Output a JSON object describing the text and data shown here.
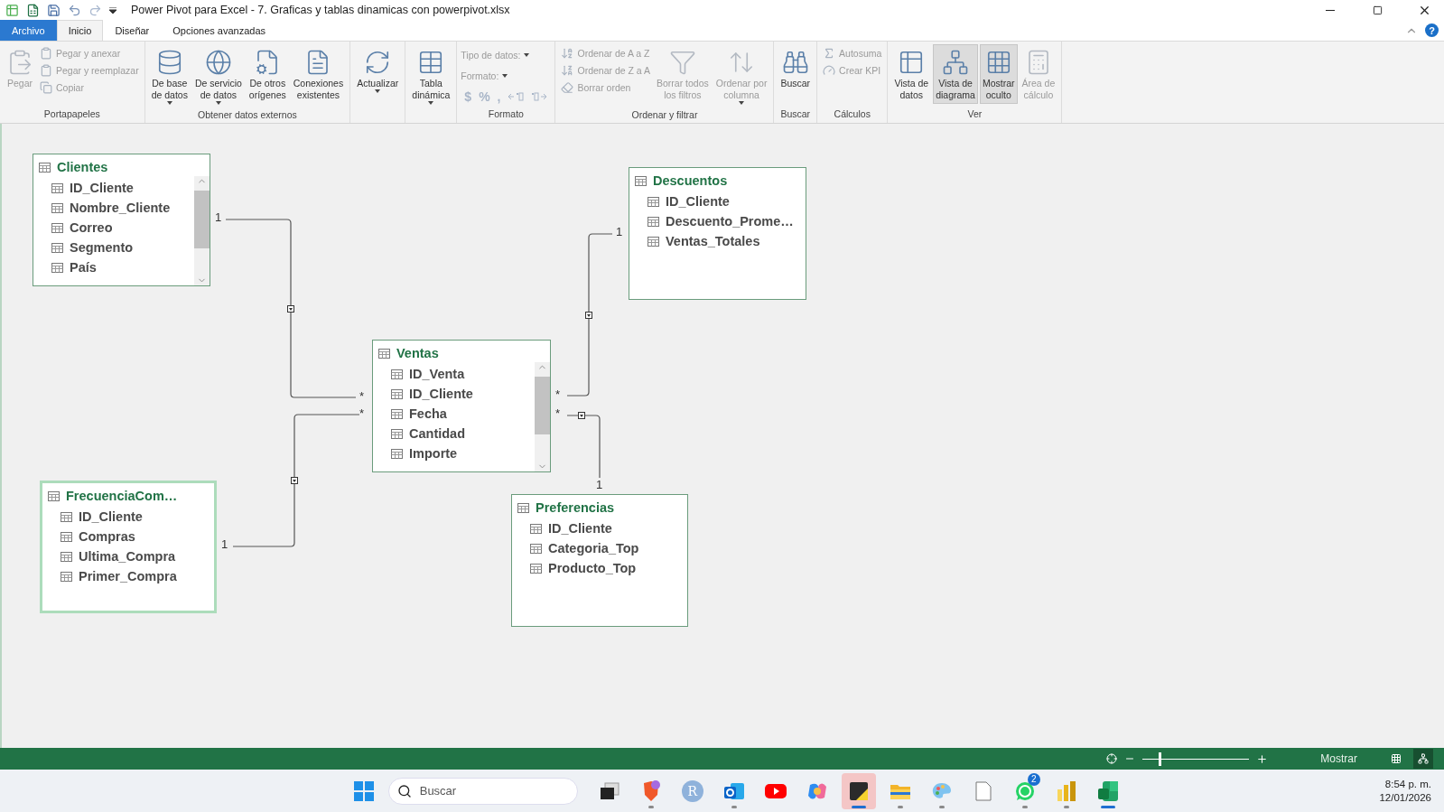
{
  "window": {
    "title": "Power Pivot para Excel - 7. Graficas y tablas dinamicas con powerpivot.xlsx",
    "help": "?"
  },
  "tabs": [
    {
      "label": "Archivo",
      "selected": false,
      "kind": "file"
    },
    {
      "label": "Inicio",
      "selected": true,
      "kind": "tab"
    },
    {
      "label": "Diseñar",
      "selected": false,
      "kind": "tab"
    },
    {
      "label": "Opciones avanzadas",
      "selected": false,
      "kind": "tab"
    }
  ],
  "ribbon": [
    {
      "label": "Portapapeles",
      "items": [
        {
          "kind": "large",
          "lines": [
            "Pegar"
          ],
          "disabled": true,
          "dropdown": false,
          "selected": false
        },
        {
          "kind": "stack",
          "items": [
            {
              "label": "Pegar y anexar",
              "disabled": true
            },
            {
              "label": "Pegar y reemplazar",
              "disabled": true
            },
            {
              "label": "Copiar",
              "disabled": true
            }
          ]
        }
      ]
    },
    {
      "label": "Obtener datos externos",
      "items": [
        {
          "kind": "large",
          "lines": [
            "De base",
            "de datos"
          ],
          "disabled": false,
          "dropdown": true,
          "selected": false
        },
        {
          "kind": "large",
          "lines": [
            "De servicio",
            "de datos"
          ],
          "disabled": false,
          "dropdown": true,
          "selected": false
        },
        {
          "kind": "large",
          "lines": [
            "De otros",
            "orígenes"
          ],
          "disabled": false,
          "dropdown": false,
          "selected": false
        },
        {
          "kind": "large",
          "lines": [
            "Conexiones",
            "existentes"
          ],
          "disabled": false,
          "dropdown": false,
          "selected": false
        }
      ]
    },
    {
      "items": [
        {
          "kind": "large",
          "lines": [
            "Actualizar"
          ],
          "disabled": false,
          "dropdown": true,
          "selected": false
        }
      ]
    },
    {
      "items": [
        {
          "kind": "large",
          "lines": [
            "Tabla",
            "dinámica"
          ],
          "disabled": false,
          "dropdown": true,
          "selected": false
        }
      ]
    },
    {
      "label": "Formato",
      "items": [
        {
          "kind": "format",
          "fields": [
            "Tipo de datos:",
            "Formato:"
          ],
          "symbols": [
            "$",
            "%",
            ","
          ],
          "disabled": true
        }
      ]
    },
    {
      "label": "Ordenar y filtrar",
      "items": [
        {
          "kind": "stack",
          "items": [
            {
              "label": "Ordenar de A a Z",
              "disabled": true
            },
            {
              "label": "Ordenar de Z a A",
              "disabled": true
            },
            {
              "label": "Borrar orden",
              "disabled": true
            }
          ]
        },
        {
          "kind": "large",
          "lines": [
            "Borrar todos",
            "los filtros"
          ],
          "disabled": true,
          "dropdown": false,
          "selected": false
        },
        {
          "kind": "large",
          "lines": [
            "Ordenar por",
            "columna"
          ],
          "disabled": true,
          "dropdown": true,
          "selected": false
        }
      ]
    },
    {
      "label": "Buscar",
      "items": [
        {
          "kind": "large",
          "lines": [
            "Buscar"
          ],
          "disabled": false,
          "dropdown": false,
          "selected": false
        }
      ]
    },
    {
      "label": "Cálculos",
      "items": [
        {
          "kind": "stack",
          "items": [
            {
              "label": "Autosuma",
              "disabled": true
            },
            {
              "label": "Crear KPI",
              "disabled": true
            }
          ]
        }
      ]
    },
    {
      "label": "Ver",
      "items": [
        {
          "kind": "large",
          "lines": [
            "Vista de",
            "datos"
          ],
          "disabled": false,
          "dropdown": false,
          "selected": false
        },
        {
          "kind": "large",
          "lines": [
            "Vista de",
            "diagrama"
          ],
          "disabled": false,
          "dropdown": false,
          "selected": true
        },
        {
          "kind": "large",
          "lines": [
            "Mostrar",
            "oculto"
          ],
          "disabled": false,
          "dropdown": false,
          "selected": true
        },
        {
          "kind": "large",
          "lines": [
            "Área de",
            "cálculo"
          ],
          "disabled": true,
          "dropdown": false,
          "selected": false
        }
      ]
    }
  ],
  "diagram": {
    "tables": [
      {
        "name": "Clientes",
        "selected": false,
        "scrollable": true,
        "fields": [
          "ID_Cliente",
          "Nombre_Cliente",
          "Correo",
          "Segmento",
          "País"
        ]
      },
      {
        "name": "Descuentos",
        "selected": false,
        "scrollable": false,
        "fields": [
          "ID_Cliente",
          "Descuento_Prome…",
          "Ventas_Totales"
        ]
      },
      {
        "name": "Ventas",
        "selected": false,
        "scrollable": true,
        "fields": [
          "ID_Venta",
          "ID_Cliente",
          "Fecha",
          "Cantidad",
          "Importe"
        ]
      },
      {
        "name": "FrecuenciaCom…",
        "selected": true,
        "scrollable": false,
        "fields": [
          "ID_Cliente",
          "Compras",
          "Ultima_Compra",
          "Primer_Compra"
        ]
      },
      {
        "name": "Preferencias",
        "selected": false,
        "scrollable": false,
        "fields": [
          "ID_Cliente",
          "Categoria_Top",
          "Producto_Top"
        ]
      }
    ],
    "relationships": [
      {
        "one": "1",
        "many": "*"
      },
      {
        "one": "1",
        "many": "*"
      },
      {
        "one": "1",
        "many": "*"
      },
      {
        "one": "1",
        "many": "*"
      }
    ]
  },
  "status_bar": {
    "zoom": {
      "level": 0.15
    },
    "show_label": "Mostrar",
    "views": [
      {
        "kind": "grid",
        "selected": false
      },
      {
        "kind": "diagram",
        "selected": true
      }
    ]
  },
  "taskbar": {
    "search": {
      "placeholder": "Buscar"
    },
    "apps": [
      {
        "kind": "taskview",
        "selected": false,
        "running": false
      },
      {
        "kind": "brave",
        "selected": false,
        "running": true
      },
      {
        "kind": "letter",
        "letter": "R",
        "selected": false,
        "running": false
      },
      {
        "kind": "outlook",
        "selected": false,
        "running": true
      },
      {
        "kind": "youtube",
        "selected": false,
        "running": false
      },
      {
        "kind": "copilot",
        "selected": false,
        "running": false
      },
      {
        "kind": "sticky",
        "selected": true,
        "running": true
      },
      {
        "kind": "folder",
        "selected": false,
        "running": true
      },
      {
        "kind": "paint",
        "selected": false,
        "running": true
      },
      {
        "kind": "file",
        "selected": false,
        "running": false
      },
      {
        "kind": "whatsapp",
        "badge": "2",
        "selected": false,
        "running": true
      },
      {
        "kind": "powerbi",
        "selected": false,
        "running": true
      },
      {
        "kind": "excel",
        "selected": true,
        "running": true
      }
    ],
    "time": "8:54 p. m.",
    "date": "12/01/2026"
  }
}
